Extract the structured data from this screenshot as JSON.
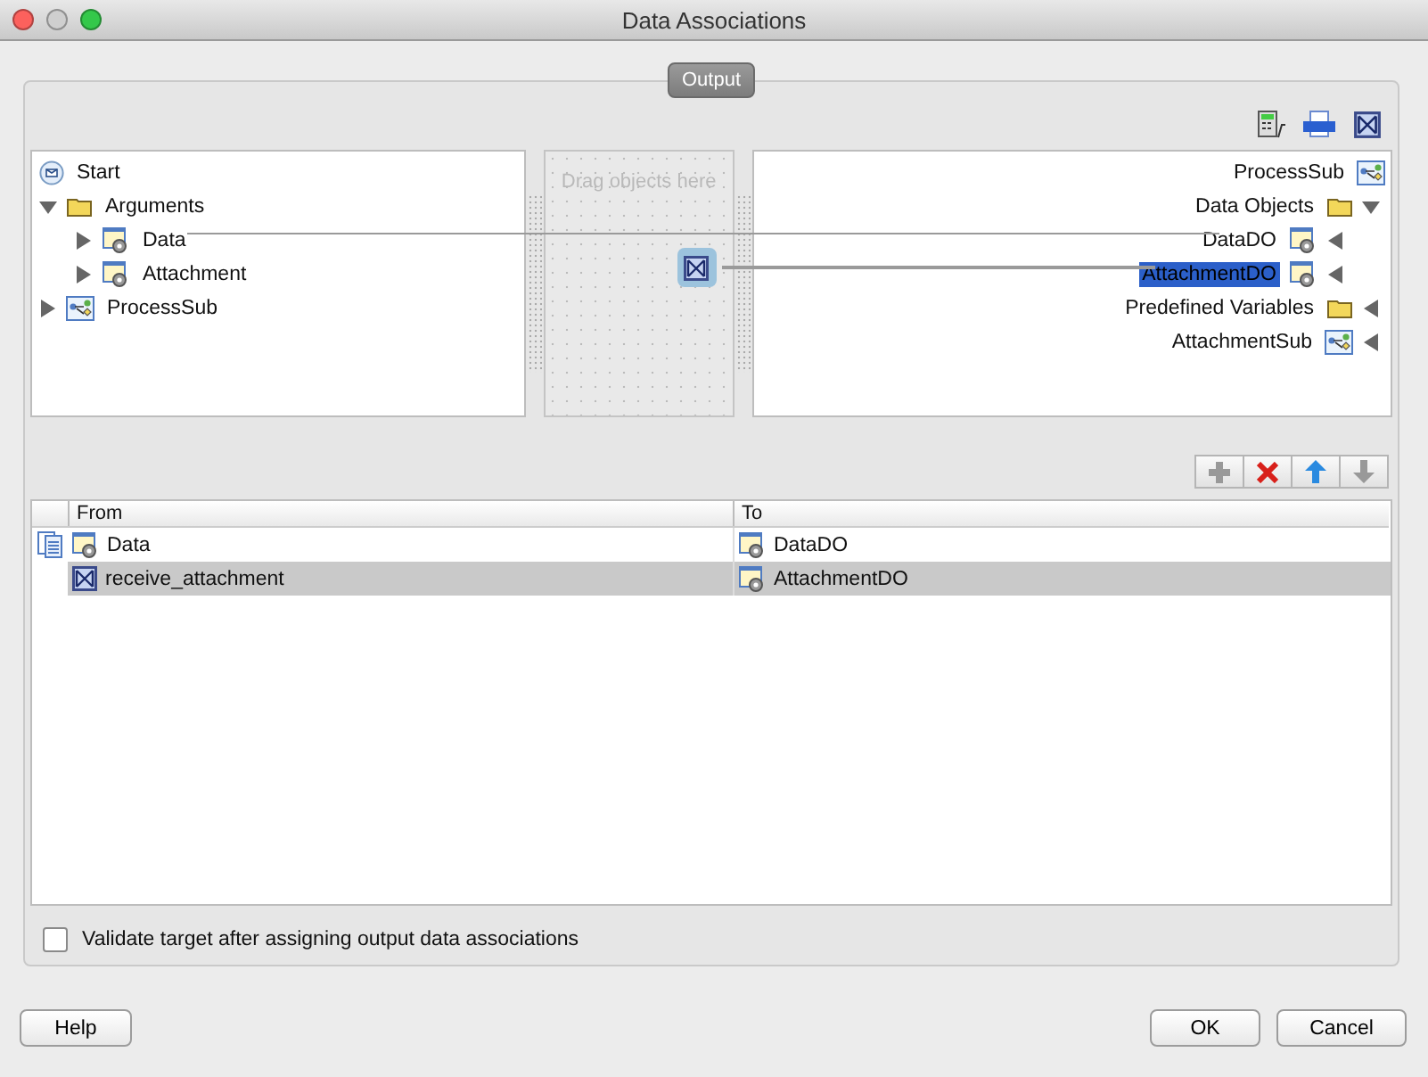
{
  "window": {
    "title": "Data Associations"
  },
  "section": {
    "title": "Output"
  },
  "source_tree": [
    {
      "label": "Start",
      "kind": "start"
    },
    {
      "label": "Arguments",
      "kind": "folder",
      "expanded": true,
      "children": [
        {
          "label": "Data",
          "kind": "variable",
          "expanded": false
        },
        {
          "label": "Attachment",
          "kind": "variable",
          "expanded": false
        }
      ]
    },
    {
      "label": "ProcessSub",
      "kind": "process",
      "expanded": false
    }
  ],
  "canvas": {
    "hint": "Drag objects here"
  },
  "target_tree": [
    {
      "label": "ProcessSub",
      "kind": "process",
      "selected": false
    },
    {
      "label": "Data Objects",
      "kind": "folder",
      "expanded": true,
      "selected": false,
      "children": [
        {
          "label": "DataDO",
          "kind": "variable",
          "expanded": false,
          "selected": false
        },
        {
          "label": "AttachmentDO",
          "kind": "variable",
          "expanded": false,
          "selected": true
        }
      ]
    },
    {
      "label": "Predefined Variables",
      "kind": "folder",
      "expanded": false,
      "selected": false
    },
    {
      "label": "AttachmentSub",
      "kind": "process",
      "expanded": false,
      "selected": false
    }
  ],
  "row_buttons": [
    {
      "kind": "add",
      "disabled": true
    },
    {
      "kind": "delete",
      "disabled": false
    },
    {
      "kind": "up",
      "disabled": false
    },
    {
      "kind": "down",
      "disabled": true
    }
  ],
  "table": {
    "columns": [
      "From",
      "To"
    ],
    "rows": [
      {
        "from": {
          "label": "Data",
          "kind": "variable"
        },
        "to": {
          "label": "DataDO",
          "kind": "variable"
        },
        "current": true,
        "selected": false
      },
      {
        "from": {
          "label": "receive_attachment",
          "kind": "function"
        },
        "to": {
          "label": "AttachmentDO",
          "kind": "variable"
        },
        "current": false,
        "selected": true
      }
    ]
  },
  "validate": {
    "label": "Validate target after assigning output data associations",
    "checked": false
  },
  "buttons": {
    "help": "Help",
    "ok": "OK",
    "cancel": "Cancel"
  }
}
